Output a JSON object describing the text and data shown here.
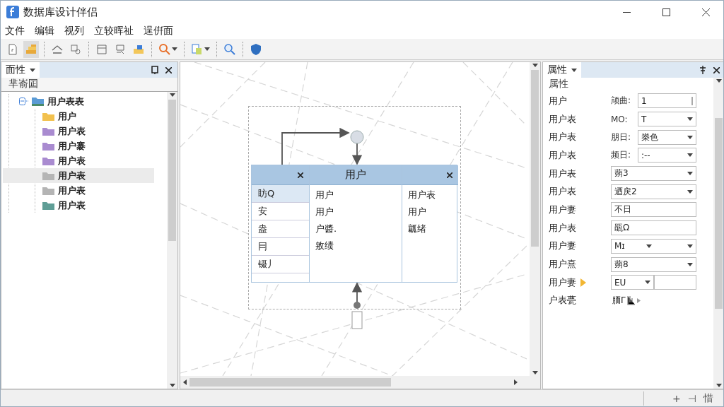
{
  "window": {
    "title": "数据库设计伴侣"
  },
  "menu": [
    "文件",
    "编辑",
    "视列",
    "立较晖祉",
    "逞倂面"
  ],
  "left_panel": {
    "title": "面性",
    "subtitle": "芈嵛囸",
    "tree": [
      {
        "label": "用户表表",
        "expanded": true,
        "selected": false,
        "children": [
          {
            "label": "用户",
            "color": "#f2c14e",
            "selected": false
          },
          {
            "label": "用户表",
            "color": "#a98bd0",
            "selected": false
          },
          {
            "label": "用户褰",
            "color": "#a98bd0",
            "selected": false
          },
          {
            "label": "用户表",
            "color": "#a98bd0",
            "selected": false
          },
          {
            "label": "用户表",
            "color": "#b4b4b4",
            "selected": true
          },
          {
            "label": "用户表",
            "color": "#b4b4b4",
            "selected": false
          },
          {
            "label": "用户表",
            "color": "#5f9e96",
            "selected": false
          }
        ]
      }
    ]
  },
  "canvas": {
    "entity": {
      "title": "用户",
      "left_rows": [
        {
          "label": "眆Q",
          "selected": true
        },
        {
          "label": "安",
          "selected": false
        },
        {
          "label": "盎",
          "selected": false
        },
        {
          "label": "冃",
          "selected": false
        },
        {
          "label": "镊丿",
          "selected": false
        }
      ],
      "middle_rows": [
        "用户",
        "用户",
        "户醬.",
        "敫绩"
      ],
      "right_rows": [
        "用户表",
        "用户",
        "瓤绪"
      ]
    }
  },
  "properties": {
    "title": "属性",
    "section": "属性",
    "rows": [
      {
        "label": "用户",
        "field_label": "颃曲:",
        "value": "1",
        "kind": "text",
        "marked": false
      },
      {
        "label": "用户表",
        "field_label": "MO:",
        "value": "T",
        "kind": "dropdown",
        "marked": false
      },
      {
        "label": "用户表",
        "field_label": "朋日:",
        "value": "桊色",
        "kind": "dropdown",
        "marked": false
      },
      {
        "label": "用户表",
        "field_label": "频日:",
        "value": ":--",
        "kind": "dropdown",
        "marked": false
      },
      {
        "label": "用户表",
        "value": "蒴3",
        "kind": "dropdown",
        "marked": false
      },
      {
        "label": "用户表",
        "value": "迺戾2",
        "kind": "dropdown",
        "marked": false
      },
      {
        "label": "用户妻",
        "value": "不日",
        "kind": "text",
        "marked": false
      },
      {
        "label": "用户表",
        "value": "瓹Ω",
        "kind": "text",
        "marked": false
      },
      {
        "label": "用户妻",
        "value": "Mɪ",
        "kind": "split",
        "marked": false
      },
      {
        "label": "用户熹",
        "value": "蒴8",
        "kind": "dropdown",
        "marked": false
      },
      {
        "label": "用户妻",
        "value": "EU",
        "kind": "split-box",
        "marked": true
      },
      {
        "label": "户表甍",
        "value": "胹Γ",
        "kind": "plain",
        "marked": false
      }
    ]
  },
  "status_bar": [
    "+",
    "⊣",
    "惜"
  ]
}
